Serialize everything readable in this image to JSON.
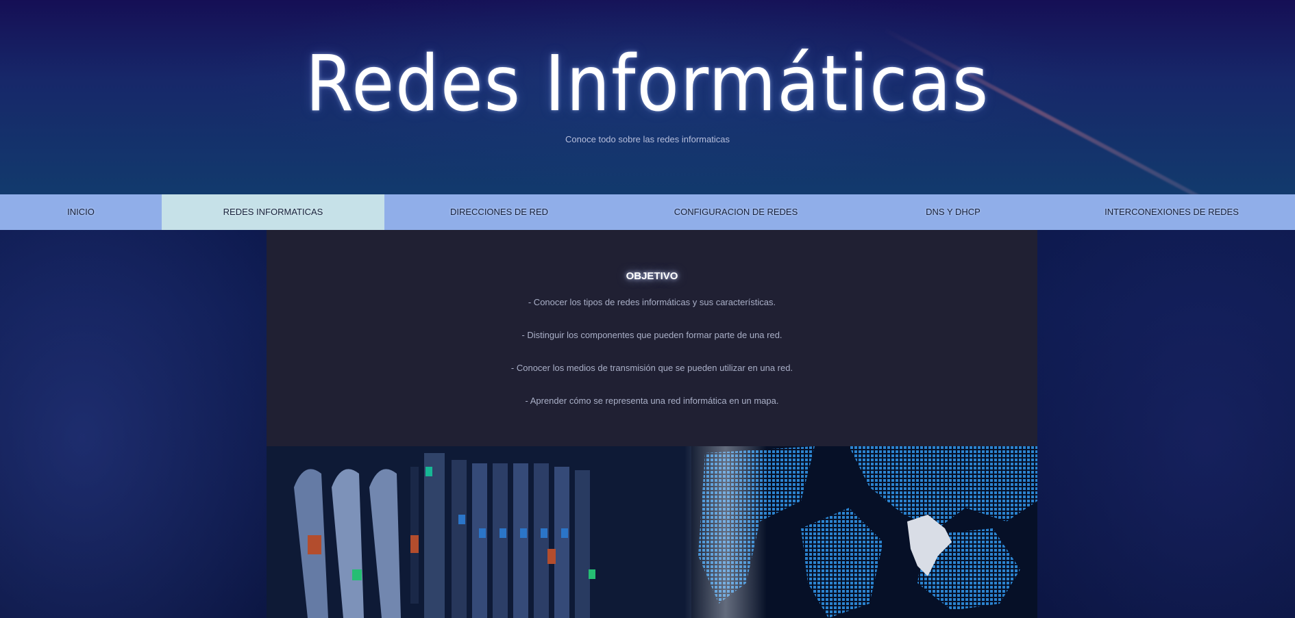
{
  "header": {
    "title": "Redes Informáticas",
    "subtitle": "Conoce todo sobre las redes informaticas"
  },
  "nav": {
    "items": [
      {
        "label": "INICIO"
      },
      {
        "label": "REDES INFORMATICAS",
        "active": true
      },
      {
        "label": "DIRECCIONES DE RED"
      },
      {
        "label": "CONFIGURACION DE REDES"
      },
      {
        "label": "DNS Y DHCP"
      },
      {
        "label": "INTERCONEXIONES DE REDES"
      }
    ]
  },
  "main": {
    "heading": "OBJETIVO",
    "objectives": [
      "- Conocer los tipos de redes informáticas y sus características.",
      "- Distinguir los componentes que pueden formar parte de una red.",
      "- Conocer los medios de transmisión que se pueden utilizar en una red.",
      "- Aprender cómo se representa una red informática en un mapa."
    ]
  },
  "banner": {
    "image": "server-rack-world-map-photo"
  },
  "colors": {
    "nav_background": "#90aee9",
    "nav_active": "#c6e1e8",
    "content_background": "#202033",
    "header_top": "#150f55",
    "header_bottom": "#123a6d"
  }
}
